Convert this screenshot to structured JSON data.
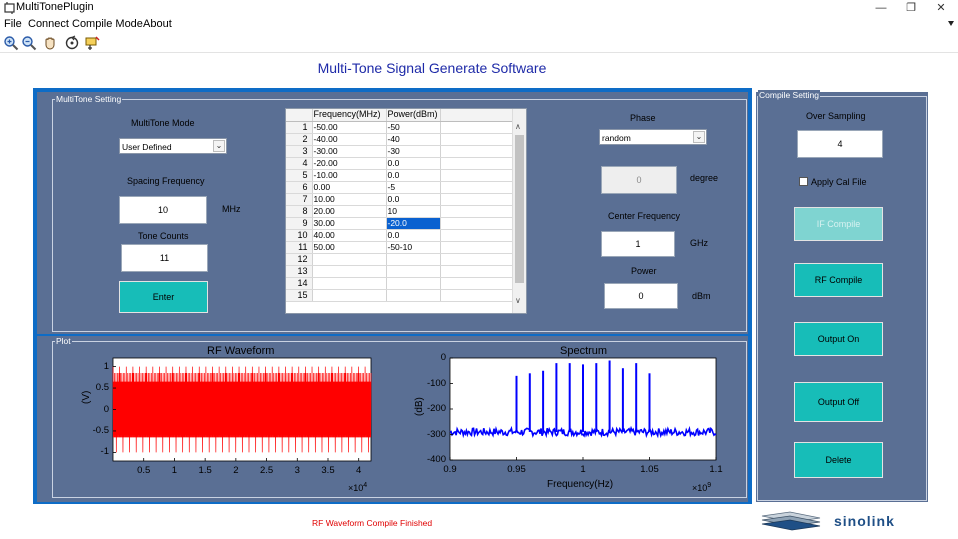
{
  "window": {
    "title": "MultiTonePlugin",
    "minimize": "—",
    "restore": "❐",
    "close": "✕"
  },
  "menu": {
    "file": "File",
    "connect": "Connect",
    "compile_mode": "Compile Mode",
    "about": "About"
  },
  "toolbar": {
    "icons": [
      "zoom-in-icon",
      "zoom-out-icon",
      "pan-icon",
      "rotate-icon",
      "data-cursor-icon"
    ]
  },
  "header": {
    "title": "Multi-Tone Signal Generate Software"
  },
  "multitone": {
    "legend": "MultiTone Setting",
    "mode_label": "MultiTone Mode",
    "mode_value": "User Defined",
    "spacing_label": "Spacing Frequency",
    "spacing_value": "10",
    "spacing_unit": "MHz",
    "tone_counts_label": "Tone Counts",
    "tone_counts_value": "11",
    "enter_button": "Enter",
    "table": {
      "headers": [
        "Frequency(MHz)",
        "Power(dBm)"
      ],
      "rows": [
        [
          "1",
          "-50.00",
          "-50"
        ],
        [
          "2",
          "-40.00",
          "-40"
        ],
        [
          "3",
          "-30.00",
          "-30"
        ],
        [
          "4",
          "-20.00",
          "0.0"
        ],
        [
          "5",
          "-10.00",
          "0.0"
        ],
        [
          "6",
          "0.00",
          "-5"
        ],
        [
          "7",
          "10.00",
          "0.0"
        ],
        [
          "8",
          "20.00",
          "10"
        ],
        [
          "9",
          "30.00",
          "-20.0"
        ],
        [
          "10",
          "40.00",
          "0.0"
        ],
        [
          "11",
          "50.00",
          "-50-10"
        ],
        [
          "12",
          "",
          ""
        ],
        [
          "13",
          "",
          ""
        ],
        [
          "14",
          "",
          ""
        ],
        [
          "15",
          "",
          ""
        ]
      ],
      "selected_cell": "-20.0"
    },
    "phase_label": "Phase",
    "phase_value": "random",
    "phase_degree_value": "0",
    "phase_degree_unit": "degree",
    "center_freq_label": "Center Frequency",
    "center_freq_value": "1",
    "center_freq_unit": "GHz",
    "power_label": "Power",
    "power_value": "0",
    "power_unit": "dBm"
  },
  "compile": {
    "legend": "Compile Setting",
    "oversampling_label": "Over Sampling",
    "oversampling_value": "4",
    "apply_cal_label": "Apply Cal File",
    "apply_cal_checked": false,
    "if_compile_button": "IF Compile",
    "rf_compile_button": "RF Compile",
    "output_on_button": "Output On",
    "output_off_button": "Output Off",
    "delete_button": "Delete"
  },
  "plot": {
    "legend": "Plot"
  },
  "chart_data": [
    {
      "type": "line",
      "title": "RF Waveform",
      "xlabel": "",
      "ylabel": "(V)",
      "xlim": [
        0,
        42000
      ],
      "ylim": [
        -1.2,
        1.2
      ],
      "x_ticks": [
        0.5,
        1,
        1.5,
        2,
        2.5,
        3,
        3.5,
        4
      ],
      "x_tick_labels": [
        "0.5",
        "1",
        "1.5",
        "2",
        "2.5",
        "3",
        "3.5",
        "4"
      ],
      "x_multiplier": "×10",
      "x_multiplier_exp": "4",
      "y_ticks": [
        1,
        0.5,
        0,
        -0.5,
        -1
      ],
      "y_tick_labels": [
        "1",
        "0.5",
        "0",
        "-0.5",
        "-1"
      ],
      "series_color": "#ff0000",
      "envelope": {
        "dense_min": -0.5,
        "dense_max": 0.5,
        "peak_min": -1.0,
        "peak_max": 1.0
      }
    },
    {
      "type": "line",
      "title": "Spectrum",
      "xlabel": "Frequency(Hz)",
      "ylabel": "(dB)",
      "xlim": [
        0.9,
        1.1
      ],
      "ylim": [
        -400,
        0
      ],
      "x_ticks": [
        0.9,
        0.95,
        1,
        1.05,
        1.1
      ],
      "x_tick_labels": [
        "0.9",
        "0.95",
        "1",
        "1.05",
        "1.1"
      ],
      "x_multiplier": "×10",
      "x_multiplier_exp": "9",
      "y_ticks": [
        0,
        -100,
        -200,
        -300,
        -400
      ],
      "y_tick_labels": [
        "0",
        "-100",
        "-200",
        "-300",
        "-400"
      ],
      "series_color": "#0000ff",
      "noise_floor": -290,
      "tones": [
        {
          "x": 0.95,
          "y": -70
        },
        {
          "x": 0.96,
          "y": -60
        },
        {
          "x": 0.97,
          "y": -50
        },
        {
          "x": 0.98,
          "y": -20
        },
        {
          "x": 0.99,
          "y": -20
        },
        {
          "x": 1.0,
          "y": -25
        },
        {
          "x": 1.01,
          "y": -20
        },
        {
          "x": 1.02,
          "y": -10
        },
        {
          "x": 1.03,
          "y": -40
        },
        {
          "x": 1.04,
          "y": -20
        },
        {
          "x": 1.05,
          "y": -60
        }
      ]
    }
  ],
  "status": {
    "message": "RF Waveform Compile Finished"
  },
  "brand": {
    "logo_text": "sinolink"
  }
}
